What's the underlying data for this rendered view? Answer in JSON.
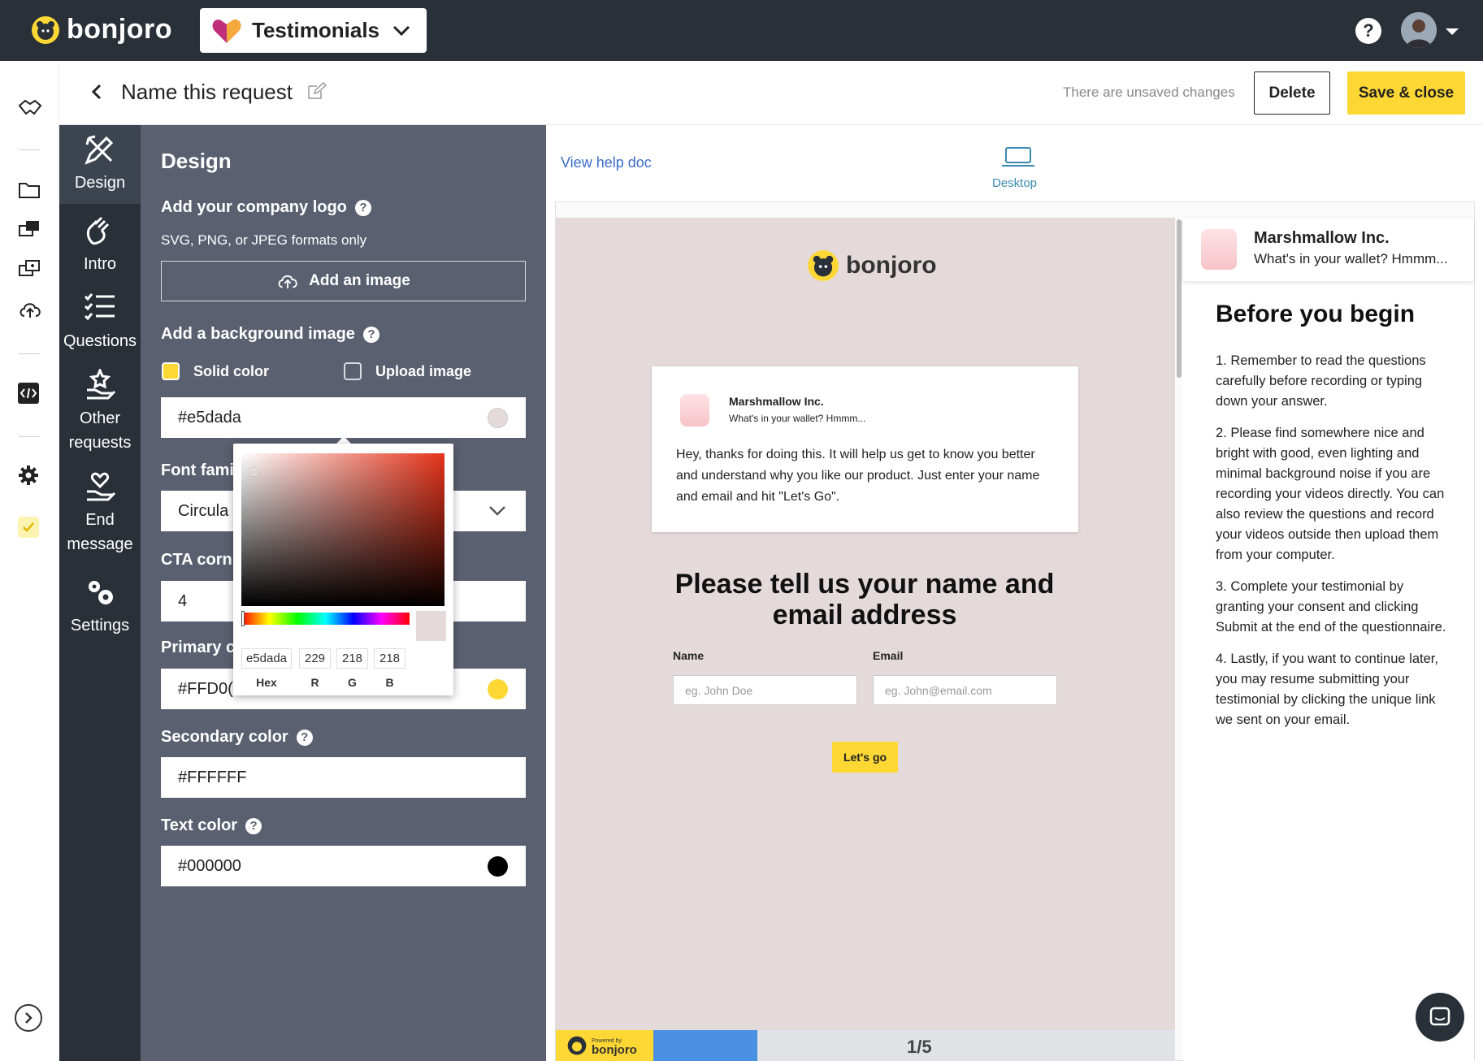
{
  "topbar": {
    "brand": "bonjoro",
    "product": "Testimonials",
    "help": "?"
  },
  "header": {
    "title": "Name this request",
    "unsaved": "There are unsaved changes",
    "delete_label": "Delete",
    "save_label": "Save & close"
  },
  "tabs": [
    {
      "label": "Design",
      "icon": "design-icon"
    },
    {
      "label": "Intro",
      "icon": "wave-hand-icon"
    },
    {
      "label": "Questions",
      "icon": "checklist-icon"
    },
    {
      "label": "Other requests",
      "icon": "star-hand-icon"
    },
    {
      "label": "End message",
      "icon": "heart-hand-icon"
    },
    {
      "label": "Settings",
      "icon": "gears-icon"
    }
  ],
  "panel": {
    "title": "Design",
    "logo_label": "Add your company logo",
    "logo_hint": "SVG, PNG, or JPEG formats only",
    "add_image": "Add an image",
    "bg_label": "Add a background image",
    "solid_color": "Solid color",
    "upload_image": "Upload image",
    "bg_value": "#e5dada",
    "font_label": "Font famil",
    "font_value": "Circula",
    "cta_label": "CTA corn",
    "cta_value": "4",
    "primary_label": "Primary c",
    "primary_value": "#FFD0(",
    "secondary_label": "Secondary color",
    "secondary_value": "#FFFFFF",
    "text_label": "Text color",
    "text_value": "#000000"
  },
  "picker": {
    "hex": "e5dada",
    "r": "229",
    "g": "218",
    "b": "218",
    "hex_lbl": "Hex",
    "r_lbl": "R",
    "g_lbl": "G",
    "b_lbl": "B"
  },
  "preview": {
    "help_doc": "View help doc",
    "device": "Desktop",
    "brand": "bonjoro",
    "company": "Marshmallow Inc.",
    "tagline": "What's in your wallet? Hmmm...",
    "message": "Hey, thanks for doing this. It will help us get to know you better and understand why you like our product. Just enter your name and email and hit \"Let's Go\".",
    "ask": "Please tell us your name and email address",
    "name_label": "Name",
    "email_label": "Email",
    "name_placeholder": "eg. John Doe",
    "email_placeholder": "eg. John@email.com",
    "go": "Let's go",
    "powered_small": "Powered by",
    "powered_brand": "bonjoro",
    "page": "1/5",
    "progress": 0.2
  },
  "sidebar": {
    "company": "Marshmallow Inc.",
    "tagline": "What's in your wallet? Hmmm...",
    "heading": "Before you begin",
    "steps": [
      "1. Remember to read the questions carefully before recording or typing down your answer.",
      "2. Please find somewhere nice and bright with good, even lighting and minimal background noise if you are recording your videos directly. You can also review the questions and record your videos outside then upload them from your computer.",
      "3. Complete your testimonial by granting your consent and clicking Submit at the end of the questionnaire.",
      "4. Lastly, if you want to continue later, you may resume submitting your testimonial by clicking the unique link we sent on your email."
    ]
  },
  "colors": {
    "accent": "#fdd835",
    "dark": "#2a3038",
    "panel": "#5b6070",
    "link": "#3a6cc6",
    "bg": "#e5dada"
  }
}
